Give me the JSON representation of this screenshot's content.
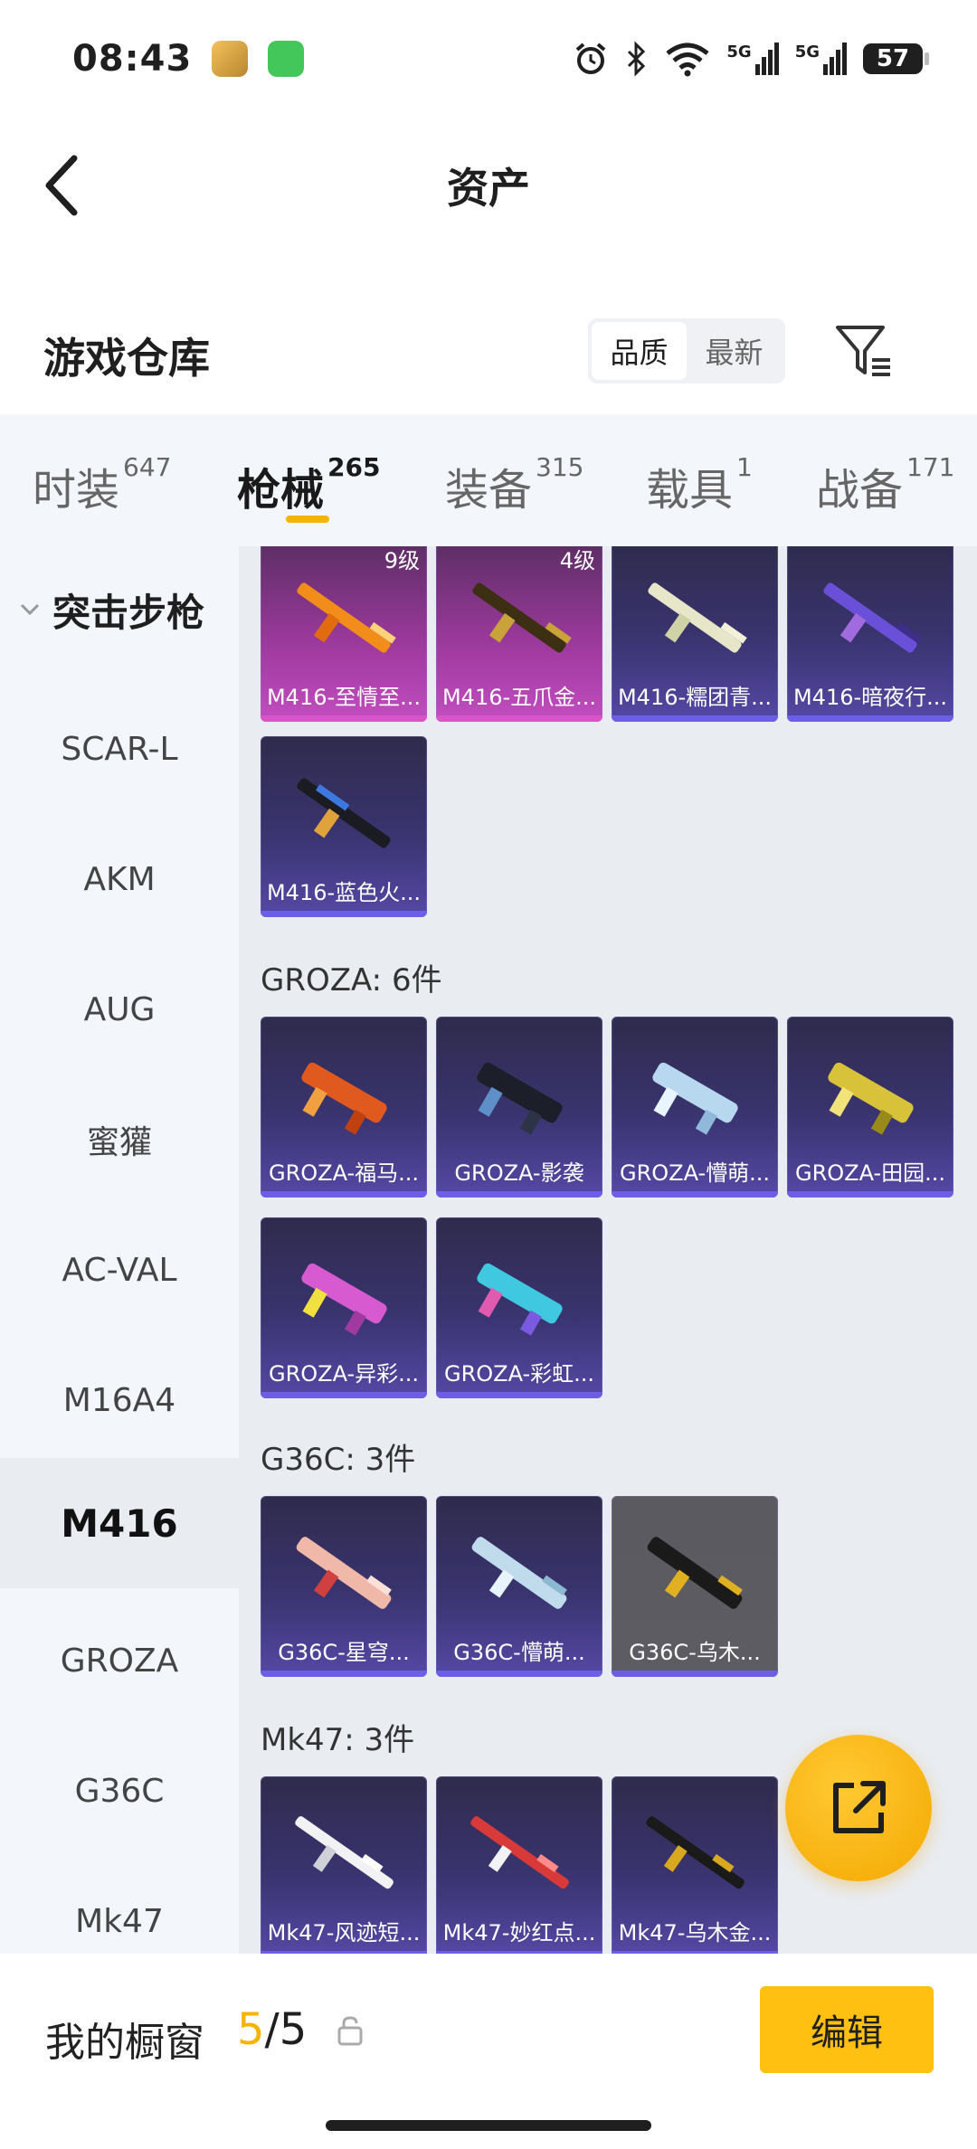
{
  "status_bar": {
    "time": "08:43",
    "signal1": "5G",
    "signal2": "5G",
    "battery": "57"
  },
  "header": {
    "title": "资产"
  },
  "warehouse": {
    "title": "游戏仓库",
    "sort_quality": "品质",
    "sort_latest": "最新"
  },
  "tabs": [
    {
      "label": "时装",
      "count": "647"
    },
    {
      "label": "枪械",
      "count": "265"
    },
    {
      "label": "装备",
      "count": "315"
    },
    {
      "label": "载具",
      "count": "1"
    },
    {
      "label": "战备",
      "count": "171"
    }
  ],
  "sidebar": {
    "group": "突击步枪",
    "items": [
      "SCAR-L",
      "AKM",
      "AUG",
      "蜜獾",
      "AC-VAL",
      "M16A4",
      "M416",
      "GROZA",
      "G36C",
      "Mk47"
    ],
    "active": "M416"
  },
  "content": {
    "m416_cards": [
      {
        "name": "M416-至情至...",
        "level": "9级"
      },
      {
        "name": "M416-五爪金...",
        "level": "4级"
      },
      {
        "name": "M416-糯团青..."
      },
      {
        "name": "M416-暗夜行..."
      },
      {
        "name": "M416-蓝色火..."
      }
    ],
    "groza_title": "GROZA: 6件",
    "groza_cards": [
      {
        "name": "GROZA-福马..."
      },
      {
        "name": "GROZA-影袭"
      },
      {
        "name": "GROZA-懵萌..."
      },
      {
        "name": "GROZA-田园..."
      },
      {
        "name": "GROZA-异彩..."
      },
      {
        "name": "GROZA-彩虹..."
      }
    ],
    "g36c_title": "G36C: 3件",
    "g36c_cards": [
      {
        "name": "G36C-星穹..."
      },
      {
        "name": "G36C-懵萌..."
      },
      {
        "name": "G36C-乌木..."
      }
    ],
    "mk47_title": "Mk47: 3件",
    "mk47_cards": [
      {
        "name": "Mk47-风迹短..."
      },
      {
        "name": "Mk47-妙红点..."
      },
      {
        "name": "Mk47-乌木金..."
      }
    ]
  },
  "bottom": {
    "showcase_label": "我的橱窗",
    "used": "5",
    "separator": "/",
    "total": "5",
    "edit_label": "编辑"
  },
  "colors": {
    "accent": "#f5b400",
    "card_blue": "#3a3470",
    "card_purple": "#a03aa0",
    "card_gray": "#5c5c62"
  }
}
